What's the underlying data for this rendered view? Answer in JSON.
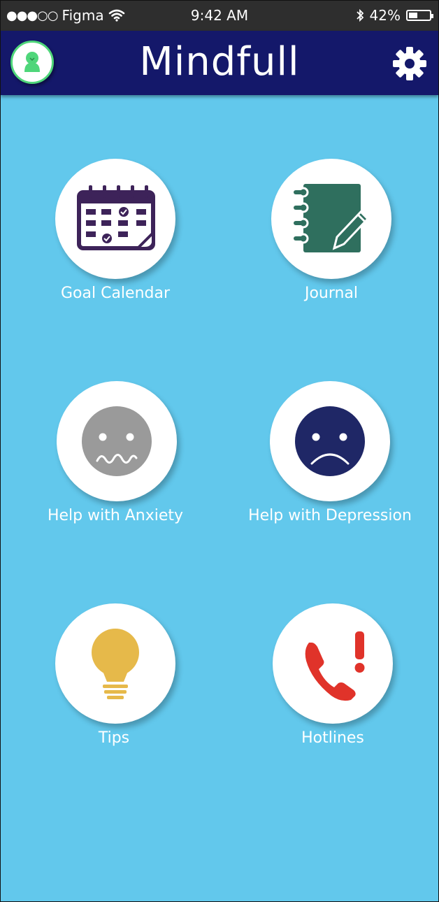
{
  "status_bar": {
    "signal": "●●●○○",
    "carrier": "Figma",
    "time": "9:42 AM",
    "battery_percent": "42%",
    "battery_level": 0.42
  },
  "header": {
    "title": "Mindfull",
    "profile_icon": "profile-icon",
    "settings_icon": "gear-icon"
  },
  "tiles": [
    {
      "label": "Goal Calendar",
      "icon": "calendar-icon"
    },
    {
      "label": "Journal",
      "icon": "journal-icon"
    },
    {
      "label": "Help with Anxiety",
      "icon": "anxious-face-icon"
    },
    {
      "label": "Help with Depression",
      "icon": "sad-face-icon"
    },
    {
      "label": "Tips",
      "icon": "lightbulb-icon"
    },
    {
      "label": "Hotlines",
      "icon": "phone-alert-icon"
    }
  ],
  "colors": {
    "background": "#62c8ec",
    "header": "#14186a",
    "calendar": "#3d2359",
    "journal": "#2f6f5e",
    "anxiety": "#9a9a9a",
    "depression": "#1f2766",
    "tips": "#e6b94a",
    "hotlines": "#e0332a"
  }
}
